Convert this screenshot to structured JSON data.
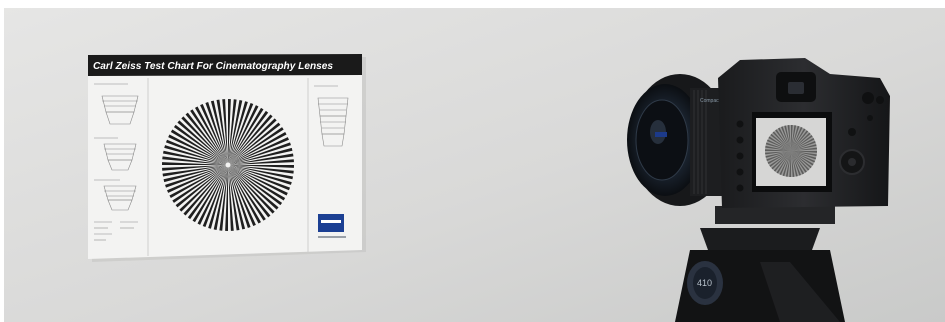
{
  "scene": {
    "wall_color": "#dcdcdb",
    "chart_title": "Carl Zeiss Test Chart For Cinematography Lenses",
    "chart_header_color": "#1a1a1a",
    "siemens_star_spokes": 72,
    "lens_brand_text": "Compact",
    "tripod_badge_text": "410",
    "icons": [
      "siemens-star",
      "zeiss-logo",
      "camera",
      "tripod"
    ]
  }
}
